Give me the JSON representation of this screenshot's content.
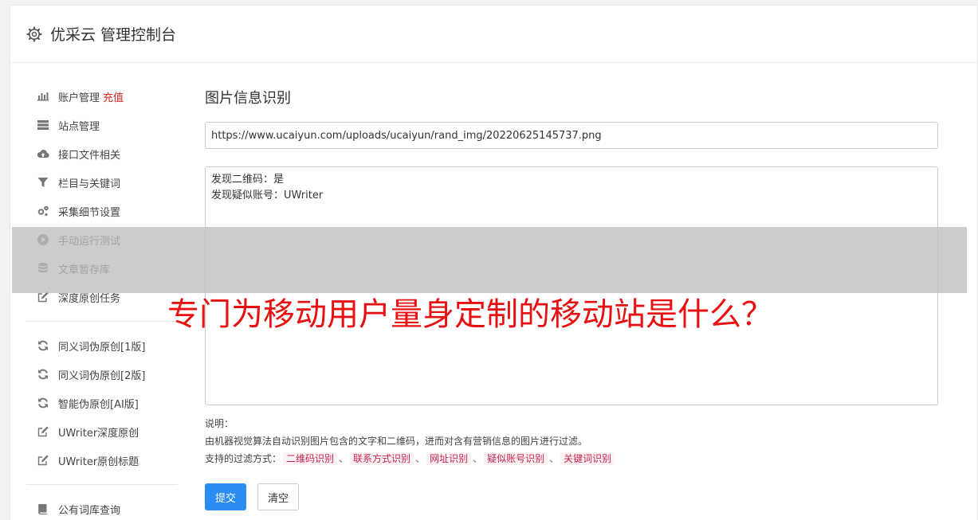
{
  "header": {
    "title": "优采云 管理控制台"
  },
  "sidebar": {
    "group1": [
      {
        "label": "账户管理",
        "badge": "充值",
        "icon": "bar-chart-icon"
      },
      {
        "label": "站点管理",
        "icon": "server-icon"
      },
      {
        "label": "接口文件相关",
        "icon": "cloud-upload-icon"
      },
      {
        "label": "栏目与关键词",
        "icon": "filter-icon"
      },
      {
        "label": "采集细节设置",
        "icon": "gears-icon"
      },
      {
        "label": "手动运行测试",
        "icon": "play-icon"
      },
      {
        "label": "文章暂存库",
        "icon": "database-icon"
      },
      {
        "label": "深度原创任务",
        "icon": "edit-icon"
      }
    ],
    "group2": [
      {
        "label": "同义词伪原创[1版]",
        "icon": "refresh-icon"
      },
      {
        "label": "同义词伪原创[2版]",
        "icon": "refresh-icon"
      },
      {
        "label": "智能伪原创[AI版]",
        "icon": "refresh-icon"
      },
      {
        "label": "UWriter深度原创",
        "icon": "edit-icon"
      },
      {
        "label": "UWriter原创标题",
        "icon": "edit-icon"
      }
    ],
    "group3": [
      {
        "label": "公有词库查询",
        "icon": "book-icon"
      }
    ]
  },
  "main": {
    "title": "图片信息识别",
    "url_value": "https://www.ucaiyun.com/uploads/ucaiyun/rand_img/20220625145737.png",
    "result_lines": [
      "发现二维码：是",
      "发现疑似账号：UWriter"
    ],
    "notes": {
      "label": "说明：",
      "description": "由机器视觉算法自动识别图片包含的文字和二维码，进而对含有营销信息的图片进行过滤。",
      "filters_label": "支持的过滤方式：",
      "filters": [
        "二维码识别",
        "联系方式识别",
        "网址识别",
        "疑似账号识别",
        "关键词识别"
      ],
      "separator": "、"
    },
    "submit_label": "提交",
    "clear_label": "清空"
  },
  "overlay": {
    "caption": "专门为移动用户量身定制的移动站是什么？"
  },
  "colors": {
    "primary": "#2a8cf5",
    "danger": "#e02020",
    "tag_text": "#c7254e",
    "overlay_text": "#e81010"
  }
}
